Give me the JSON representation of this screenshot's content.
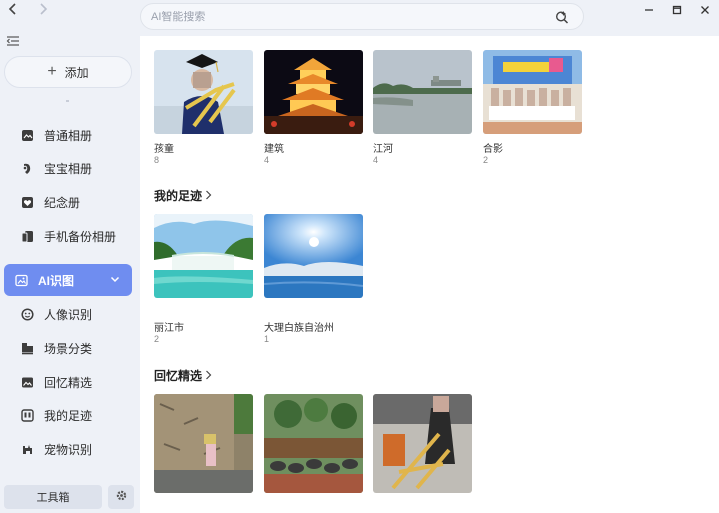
{
  "nav": {
    "back_icon": "chevron-left-icon",
    "forward_icon": "chevron-right-icon"
  },
  "sidebar": {
    "add_label": "添加",
    "items": [
      {
        "label": "普通相册",
        "icon": "album-icon"
      },
      {
        "label": "宝宝相册",
        "icon": "baby-icon"
      },
      {
        "label": "纪念册",
        "icon": "heart-icon"
      },
      {
        "label": "手机备份相册",
        "icon": "phone-backup-icon"
      },
      {
        "label": "AI识图",
        "icon": "ai-image-icon",
        "active": true
      },
      {
        "label": "人像识别",
        "icon": "face-icon"
      },
      {
        "label": "场景分类",
        "icon": "scene-icon"
      },
      {
        "label": "回忆精选",
        "icon": "memory-icon"
      },
      {
        "label": "我的足迹",
        "icon": "footprint-icon"
      },
      {
        "label": "宠物识别",
        "icon": "pet-icon"
      }
    ],
    "toolbox_label": "工具箱"
  },
  "search": {
    "placeholder": "AI智能搜索"
  },
  "scenes": [
    {
      "label": "孩童",
      "count": "8"
    },
    {
      "label": "建筑",
      "count": "4"
    },
    {
      "label": "江河",
      "count": "4"
    },
    {
      "label": "合影",
      "count": "2"
    }
  ],
  "footprints": {
    "title": "我的足迹",
    "items": [
      {
        "label": "丽江市",
        "count": "2"
      },
      {
        "label": "大理白族自治州",
        "count": "1"
      }
    ]
  },
  "memories": {
    "title": "回忆精选"
  },
  "colors": {
    "accent": "#6f8df0",
    "sidebar_bg": "#eef1f7"
  }
}
